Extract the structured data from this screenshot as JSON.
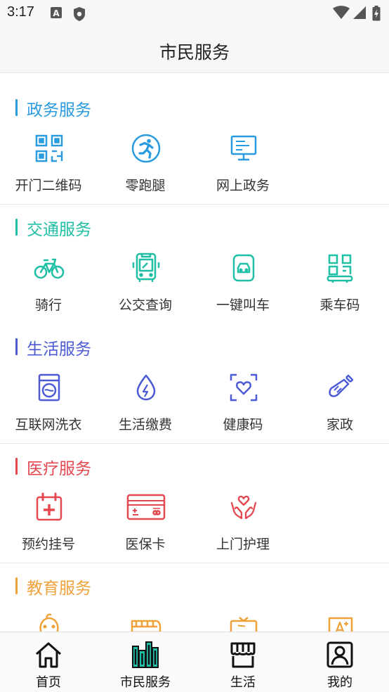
{
  "status_bar": {
    "time": "3:17",
    "left_icons": [
      "keyboard-a-icon",
      "shield-icon"
    ],
    "right_icons": [
      "wifi-icon",
      "signal-icon",
      "battery-icon"
    ]
  },
  "header": {
    "title": "市民服务"
  },
  "sections": [
    {
      "title": "政务服务",
      "color": "#2b9be0",
      "items": [
        {
          "label": "开门二维码",
          "icon": "qr-code-icon"
        },
        {
          "label": "零跑腿",
          "icon": "runner-icon"
        },
        {
          "label": "网上政务",
          "icon": "monitor-icon"
        }
      ]
    },
    {
      "title": "交通服务",
      "color": "#1fbfa6",
      "items": [
        {
          "label": "骑行",
          "icon": "bicycle-icon"
        },
        {
          "label": "公交查询",
          "icon": "bus-icon"
        },
        {
          "label": "一键叫车",
          "icon": "car-icon"
        },
        {
          "label": "乘车码",
          "icon": "ride-code-icon"
        }
      ]
    },
    {
      "title": "生活服务",
      "color": "#4c5ad6",
      "items": [
        {
          "label": "互联网洗衣",
          "icon": "washing-machine-icon"
        },
        {
          "label": "生活缴费",
          "icon": "utility-drop-icon"
        },
        {
          "label": "健康码",
          "icon": "health-code-icon"
        },
        {
          "label": "家政",
          "icon": "cleaning-spray-icon"
        }
      ]
    },
    {
      "title": "医疗服务",
      "color": "#e5474f",
      "items": [
        {
          "label": "预约挂号",
          "icon": "calendar-cross-icon"
        },
        {
          "label": "医保卡",
          "icon": "medical-card-icon"
        },
        {
          "label": "上门护理",
          "icon": "care-hands-icon"
        }
      ]
    },
    {
      "title": "教育服务",
      "color": "#f0a23a",
      "items": [
        {
          "label": "",
          "icon": "baby-icon"
        },
        {
          "label": "",
          "icon": "school-bus-icon"
        },
        {
          "label": "",
          "icon": "tv-icon"
        },
        {
          "label": "",
          "icon": "language-a-plus-icon"
        }
      ]
    }
  ],
  "tab_bar": {
    "tabs": [
      {
        "label": "首页",
        "icon": "home-icon",
        "active": false
      },
      {
        "label": "市民服务",
        "icon": "city-services-icon",
        "active": true
      },
      {
        "label": "生活",
        "icon": "store-icon",
        "active": false
      },
      {
        "label": "我的",
        "icon": "profile-icon",
        "active": false
      }
    ],
    "active_color": "#1fbfa6"
  }
}
